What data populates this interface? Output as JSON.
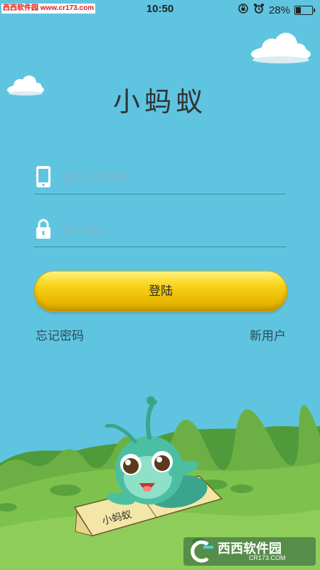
{
  "status_bar": {
    "watermark": "西西软件园 www.cr173.com",
    "time": "10:50",
    "battery": "28%",
    "battery_level": 0.28
  },
  "app": {
    "title": "小蚂蚁"
  },
  "form": {
    "phone_placeholder": "输入手机号码",
    "password_placeholder": "输入密码",
    "login_label": "登陆",
    "forgot_label": "忘记密码",
    "register_label": "新用户"
  },
  "illustration": {
    "book_text": "小蚂蚁"
  },
  "footer_logo": {
    "brand": "西西软件园",
    "url": "CR173.COM"
  },
  "colors": {
    "sky": "#5fc4e0",
    "button": "#f8d41a",
    "grass": "#7ec24e"
  }
}
